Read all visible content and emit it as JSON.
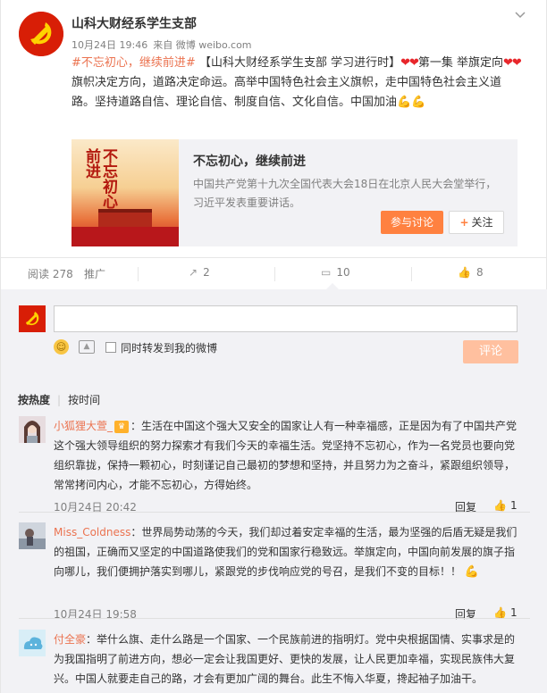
{
  "post": {
    "author": "山科大财经系学生支部",
    "date": "10月24日 19:46",
    "source": "来自 微博 weibo.com",
    "topic": "#不忘初心，继续前进#",
    "text_a": "【山科大财经系学生支部 学习进行时】",
    "text_b": "第一集 举旗定向",
    "text_c": "旗帜决定方向，道路决定命运。高举中国特色社会主义旗帜，走中国特色社会主义道路。坚持道路自信、理论自信、制度自信、文化自信。中国加油"
  },
  "share_card": {
    "image_text": "不忘初心继续前进",
    "title": "不忘初心，继续前进",
    "desc": "中国共产党第十九次全国代表大会18日在北京人民大会堂举行，习近平发表重要讲话。",
    "discuss_label": "参与讨论",
    "follow_label": "关注"
  },
  "actions": {
    "reads": "阅读 278",
    "promote": "推广",
    "repost_count": "2",
    "comment_count": "10",
    "like_count": "8"
  },
  "composer": {
    "repost_label": "同时转发到我的微博",
    "submit_label": "评论"
  },
  "sort": {
    "hot": "按热度",
    "time": "按时间"
  },
  "comments": [
    {
      "name": "小狐狸大萱_",
      "text": "：生活在中国这个强大又安全的国家让人有一种幸福感，正是因为有了中国共产党这个强大领导组织的努力探索才有我们今天的幸福生活。党坚持不忘初心，作为一名党员也要向党组织靠拢，保持一颗初心，时刻谨记自己最初的梦想和坚持，并且努力为之奋斗，紧跟组织领导，常常拷问内心，才能不忘初心，方得始终。",
      "time": "10月24日 20:42",
      "reply": "回复",
      "likes": "1"
    },
    {
      "name": "Miss_Coldness",
      "text": "：世界局势动荡的今天，我们却过着安定幸福的生活，最为坚强的后盾无疑是我们的祖国，正确而又坚定的中国道路使我们的党和国家行稳致远。举旗定向，中国向前发展的旗子指向哪儿，我们便拥护落实到哪儿，紧跟党的步伐响应党的号召，是我们不变的目标！！",
      "time": "10月24日 19:58",
      "reply": "回复",
      "likes": "1"
    },
    {
      "name": "付全豪",
      "text": "：举什么旗、走什么路是一个国家、一个民族前进的指明灯。党中央根据国情、实事求是的为我国指明了前进方向，想必一定会让我国更好、更快的发展，让人民更加幸福，实现民族伟大复兴。中国人就要走自己的路，才会有更加广阔的舞台。此生不悔入华夏，搀起袖子加油干。"
    }
  ],
  "colors": {
    "accent": "#eb7350",
    "party_red": "#d81e06",
    "button_orange": "#ff8140"
  }
}
